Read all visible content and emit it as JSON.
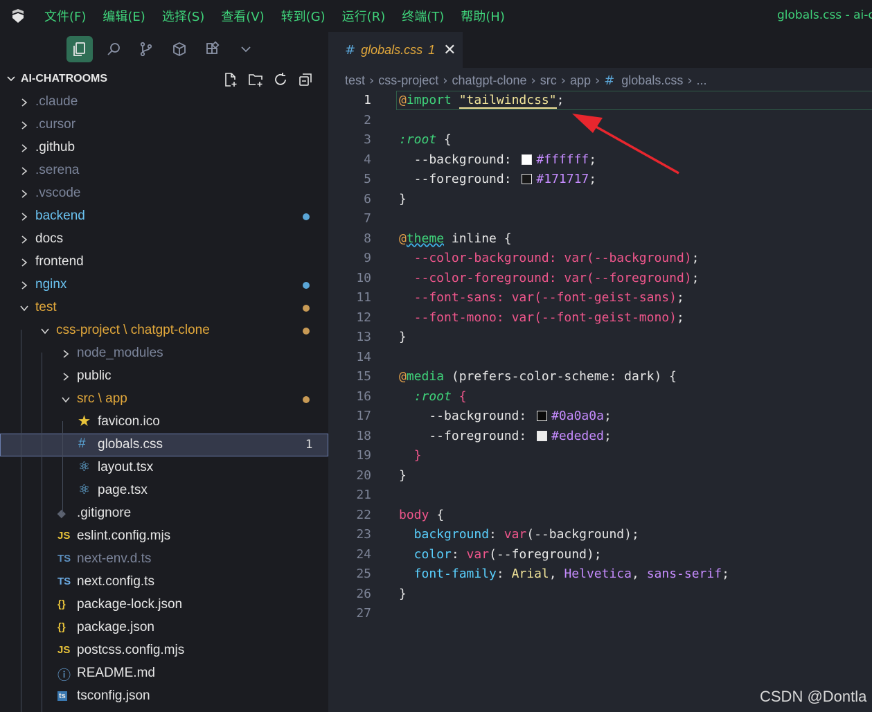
{
  "window": {
    "title": "globals.css - ai-ch",
    "menu": [
      "文件(F)",
      "编辑(E)",
      "选择(S)",
      "查看(V)",
      "转到(G)",
      "运行(R)",
      "终端(T)",
      "帮助(H)"
    ]
  },
  "activity_bar": {
    "icons": [
      "explorer-icon",
      "search-icon",
      "source-control-icon",
      "extensions-box-icon",
      "extensions-grid-icon",
      "chevron-down-icon"
    ],
    "active": "explorer-icon"
  },
  "tab": {
    "icon_glyph": "#",
    "label": "globals.css",
    "problems": "1",
    "close_glyph": "✕"
  },
  "explorer": {
    "title": "AI-CHATROOMS",
    "actions": [
      "new-file-icon",
      "new-folder-icon",
      "refresh-icon",
      "collapse-all-icon"
    ],
    "items": [
      {
        "label": ".claude",
        "type": "folder",
        "expanded": false,
        "depth": 0,
        "color": "#7b849a"
      },
      {
        "label": ".cursor",
        "type": "folder",
        "expanded": false,
        "depth": 0,
        "color": "#7b849a"
      },
      {
        "label": ".github",
        "type": "folder",
        "expanded": false,
        "depth": 0,
        "color": "#e6e6e6"
      },
      {
        "label": ".serena",
        "type": "folder",
        "expanded": false,
        "depth": 0,
        "color": "#7b849a"
      },
      {
        "label": ".vscode",
        "type": "folder",
        "expanded": false,
        "depth": 0,
        "color": "#7b849a"
      },
      {
        "label": "backend",
        "type": "folder",
        "expanded": false,
        "depth": 0,
        "color": "#6ac2f0",
        "dot": "#5aa5d6"
      },
      {
        "label": "docs",
        "type": "folder",
        "expanded": false,
        "depth": 0,
        "color": "#e6e6e6"
      },
      {
        "label": "frontend",
        "type": "folder",
        "expanded": false,
        "depth": 0,
        "color": "#e6e6e6"
      },
      {
        "label": "nginx",
        "type": "folder",
        "expanded": false,
        "depth": 0,
        "color": "#6ac2f0",
        "dot": "#5aa5d6"
      },
      {
        "label": "test",
        "type": "folder",
        "expanded": true,
        "depth": 0,
        "color": "#e2a83b",
        "dot": "#c89a55"
      },
      {
        "label": "css-project \\ chatgpt-clone",
        "type": "folder",
        "expanded": true,
        "depth": 1,
        "color": "#e2a83b",
        "dot": "#c89a55"
      },
      {
        "label": "node_modules",
        "type": "folder",
        "expanded": false,
        "depth": 2,
        "color": "#7b849a"
      },
      {
        "label": "public",
        "type": "folder",
        "expanded": false,
        "depth": 2,
        "color": "#e6e6e6"
      },
      {
        "label": "src \\ app",
        "type": "folder",
        "expanded": true,
        "depth": 2,
        "color": "#e2a83b",
        "dot": "#c89a55"
      },
      {
        "label": "favicon.ico",
        "type": "file",
        "depth": 3,
        "color": "#e6e6e6",
        "icon": "star-icon",
        "icon_glyph": "★",
        "icon_color": "#e8c33a"
      },
      {
        "label": "globals.css",
        "type": "file",
        "depth": 3,
        "color": "#e6e6e6",
        "icon": "css-hash-icon",
        "icon_glyph": "#",
        "icon_color": "#5aa5d6",
        "selected": true,
        "badge": "1"
      },
      {
        "label": "layout.tsx",
        "type": "file",
        "depth": 3,
        "color": "#e6e6e6",
        "icon": "react-icon",
        "icon_glyph": "⚛",
        "icon_color": "#6ab7e8"
      },
      {
        "label": "page.tsx",
        "type": "file",
        "depth": 3,
        "color": "#e6e6e6",
        "icon": "react-icon",
        "icon_glyph": "⚛",
        "icon_color": "#6ab7e8"
      },
      {
        "label": ".gitignore",
        "type": "file",
        "depth": 2,
        "color": "#e6e6e6",
        "icon": "git-icon",
        "icon_glyph": "◆",
        "icon_color": "#5c6270"
      },
      {
        "label": "eslint.config.mjs",
        "type": "file",
        "depth": 2,
        "color": "#e6e6e6",
        "icon": "js-icon",
        "icon_glyph": "JS",
        "icon_color": "#e8c33a"
      },
      {
        "label": "next-env.d.ts",
        "type": "file",
        "depth": 2,
        "color": "#7b849a",
        "icon": "ts-icon",
        "icon_glyph": "TS",
        "icon_color": "#5c8fbf"
      },
      {
        "label": "next.config.ts",
        "type": "file",
        "depth": 2,
        "color": "#e6e6e6",
        "icon": "ts-icon",
        "icon_glyph": "TS",
        "icon_color": "#6aa8e0"
      },
      {
        "label": "package-lock.json",
        "type": "file",
        "depth": 2,
        "color": "#e6e6e6",
        "icon": "json-icon",
        "icon_glyph": "{}",
        "icon_color": "#e8c33a"
      },
      {
        "label": "package.json",
        "type": "file",
        "depth": 2,
        "color": "#e6e6e6",
        "icon": "json-icon",
        "icon_glyph": "{}",
        "icon_color": "#e8c33a"
      },
      {
        "label": "postcss.config.mjs",
        "type": "file",
        "depth": 2,
        "color": "#e6e6e6",
        "icon": "js-icon",
        "icon_glyph": "JS",
        "icon_color": "#e8c33a"
      },
      {
        "label": "README.md",
        "type": "file",
        "depth": 2,
        "color": "#e6e6e6",
        "icon": "info-icon",
        "icon_glyph": "ⓘ",
        "icon_color": "#6aa8e0"
      },
      {
        "label": "tsconfig.json",
        "type": "file",
        "depth": 2,
        "color": "#e6e6e6",
        "icon": "tsconfig-icon",
        "icon_glyph": "ts",
        "icon_color": "#6aa8e0"
      }
    ]
  },
  "breadcrumb": [
    "test",
    "css-project",
    "chatgpt-clone",
    "src",
    "app",
    "globals.css",
    "..."
  ],
  "editor": {
    "current_line": 1,
    "lines": [
      [
        {
          "t": "@",
          "c": "at"
        },
        {
          "t": "import",
          "c": "kw"
        },
        {
          "t": " ",
          "c": "pu"
        },
        {
          "t": "\"tailwindcss\"",
          "c": "str"
        },
        {
          "t": ";",
          "c": "pu"
        }
      ],
      [],
      [
        {
          "t": ":root",
          "c": "sel"
        },
        {
          "t": " {",
          "c": "pu"
        }
      ],
      [
        {
          "t": "  --background",
          "c": "prop"
        },
        {
          "t": ": ",
          "c": "pu"
        },
        {
          "t": "",
          "c": "swatch",
          "sw": "#ffffff"
        },
        {
          "t": "#ffffff",
          "c": "hex"
        },
        {
          "t": ";",
          "c": "pu"
        }
      ],
      [
        {
          "t": "  --foreground",
          "c": "prop"
        },
        {
          "t": ": ",
          "c": "pu"
        },
        {
          "t": "",
          "c": "swatch",
          "sw": "#171717"
        },
        {
          "t": "#171717",
          "c": "hex"
        },
        {
          "t": ";",
          "c": "pu"
        }
      ],
      [
        {
          "t": "}",
          "c": "pu"
        }
      ],
      [],
      [
        {
          "t": "@",
          "c": "at"
        },
        {
          "t": "theme",
          "c": "kw squig"
        },
        {
          "t": " inline {",
          "c": "pu"
        }
      ],
      [
        {
          "t": "  --color-background: ",
          "c": "cprop"
        },
        {
          "t": "var(--background)",
          "c": "fn"
        },
        {
          "t": ";",
          "c": "pu"
        }
      ],
      [
        {
          "t": "  --color-foreground: ",
          "c": "cprop"
        },
        {
          "t": "var(--foreground)",
          "c": "fn"
        },
        {
          "t": ";",
          "c": "pu"
        }
      ],
      [
        {
          "t": "  --font-sans: ",
          "c": "cprop"
        },
        {
          "t": "var(--font-geist-sans)",
          "c": "fn"
        },
        {
          "t": ";",
          "c": "pu"
        }
      ],
      [
        {
          "t": "  --font-mono: ",
          "c": "cprop"
        },
        {
          "t": "var(--font-geist-mono)",
          "c": "fn"
        },
        {
          "t": ";",
          "c": "pu"
        }
      ],
      [
        {
          "t": "}",
          "c": "pu"
        }
      ],
      [],
      [
        {
          "t": "@",
          "c": "at"
        },
        {
          "t": "media",
          "c": "kw"
        },
        {
          "t": " (prefers-color-scheme: dark) {",
          "c": "pu"
        }
      ],
      [
        {
          "t": "  :root",
          "c": "sel"
        },
        {
          "t": " {",
          "c": "tag"
        }
      ],
      [
        {
          "t": "    --background",
          "c": "prop"
        },
        {
          "t": ": ",
          "c": "pu"
        },
        {
          "t": "",
          "c": "swatch",
          "sw": "#0a0a0a"
        },
        {
          "t": "#0a0a0a",
          "c": "hex"
        },
        {
          "t": ";",
          "c": "pu"
        }
      ],
      [
        {
          "t": "    --foreground",
          "c": "prop"
        },
        {
          "t": ": ",
          "c": "pu"
        },
        {
          "t": "",
          "c": "swatch",
          "sw": "#ededed"
        },
        {
          "t": "#ededed",
          "c": "hex"
        },
        {
          "t": ";",
          "c": "pu"
        }
      ],
      [
        {
          "t": "  }",
          "c": "tag"
        }
      ],
      [
        {
          "t": "}",
          "c": "pu"
        }
      ],
      [],
      [
        {
          "t": "body",
          "c": "tag"
        },
        {
          "t": " {",
          "c": "pu"
        }
      ],
      [
        {
          "t": "  background",
          "c": "bprop"
        },
        {
          "t": ": ",
          "c": "pu"
        },
        {
          "t": "var",
          "c": "tag"
        },
        {
          "t": "(--background)",
          "c": "pu"
        },
        {
          "t": ";",
          "c": "pu"
        }
      ],
      [
        {
          "t": "  color",
          "c": "bprop"
        },
        {
          "t": ": ",
          "c": "pu"
        },
        {
          "t": "var",
          "c": "tag"
        },
        {
          "t": "(--foreground)",
          "c": "pu"
        },
        {
          "t": ";",
          "c": "pu"
        }
      ],
      [
        {
          "t": "  font-family",
          "c": "bprop"
        },
        {
          "t": ": ",
          "c": "pu"
        },
        {
          "t": "Arial",
          "c": "str"
        },
        {
          "t": ", ",
          "c": "pu"
        },
        {
          "t": "Helvetica",
          "c": "val"
        },
        {
          "t": ", ",
          "c": "pu"
        },
        {
          "t": "sans-serif",
          "c": "val"
        },
        {
          "t": ";",
          "c": "pu"
        }
      ],
      [
        {
          "t": "}",
          "c": "pu"
        }
      ],
      []
    ]
  },
  "watermark": "CSDN @Dontla",
  "colors": {
    "accent_green": "#3fd37a",
    "annotation_arrow": "#e8262e"
  }
}
